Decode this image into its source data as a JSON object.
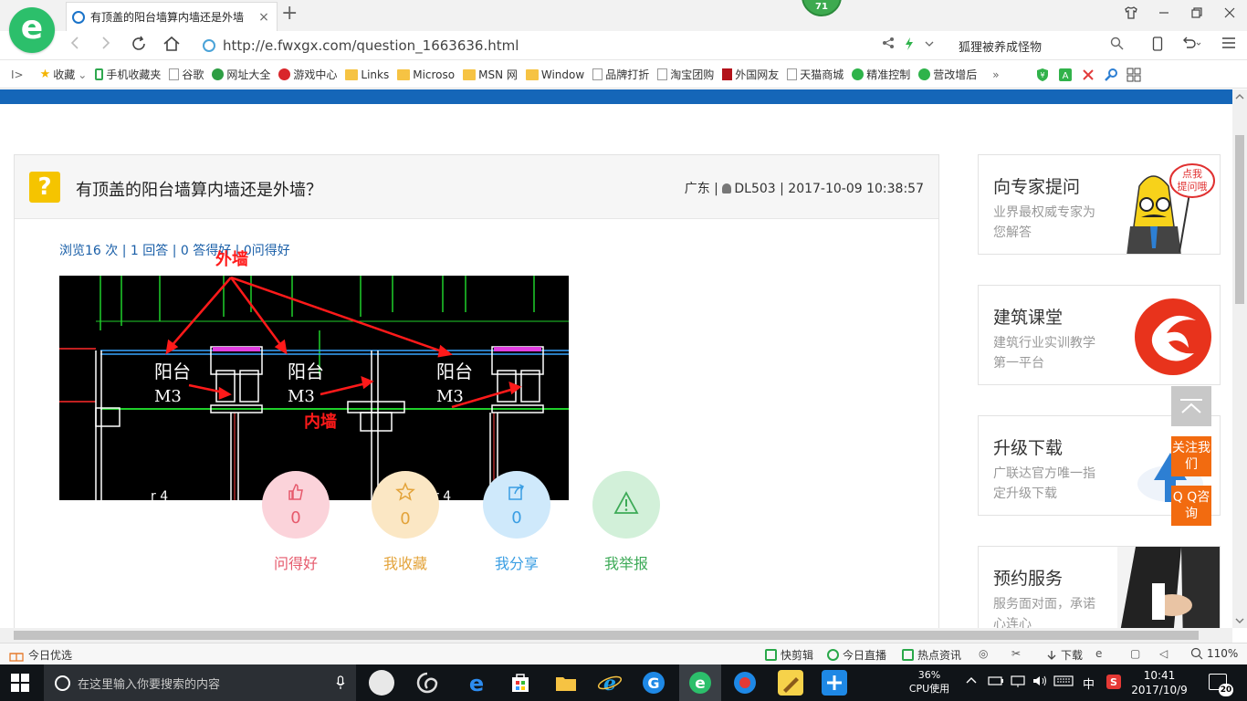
{
  "browser": {
    "tab_title": "有顶盖的阳台墙算内墙还是外墙",
    "tab_close": "×",
    "new_tab": "+",
    "ext_badge": "71",
    "url": "http://e.fwxgx.com/question_1663636.html",
    "search_hint": "狐狸被养成怪物"
  },
  "bookmarks": [
    {
      "label": "收藏",
      "icon": "star"
    },
    {
      "label": "手机收藏夹",
      "icon": "phone"
    },
    {
      "label": "谷歌",
      "icon": "page"
    },
    {
      "label": "网址大全",
      "icon": "round",
      "color": "#2e9e44"
    },
    {
      "label": "游戏中心",
      "icon": "round",
      "color": "#d9262b"
    },
    {
      "label": "Links",
      "icon": "folder"
    },
    {
      "label": "Microso",
      "icon": "folder"
    },
    {
      "label": "MSN 网",
      "icon": "folder"
    },
    {
      "label": "Window",
      "icon": "folder"
    },
    {
      "label": "品牌打折",
      "icon": "page"
    },
    {
      "label": "淘宝团购",
      "icon": "page"
    },
    {
      "label": "外国网友",
      "icon": "page",
      "color": "#b3121a"
    },
    {
      "label": "天猫商城",
      "icon": "page"
    },
    {
      "label": "精准控制",
      "icon": "round",
      "color": "#2eb34a"
    },
    {
      "label": "营改增后",
      "icon": "round",
      "color": "#2eb34a"
    }
  ],
  "bookmarks_more": "»",
  "question": {
    "title": "有顶盖的阳台墙算内墙还是外墙？",
    "region": "广东",
    "user": "DL503",
    "datetime": "2017-10-09 10:38:57",
    "stats": "浏览16 次 | 1 回答 | 0 答得好 | 0问得好"
  },
  "drawing": {
    "label_outer": "外墙",
    "label_inner": "内墙",
    "room_label": "阳台",
    "door_label": "M3"
  },
  "actions": [
    {
      "label": "问得好",
      "count": "0",
      "icon": "thumb-up-icon",
      "bg": "#fbd3da",
      "fg": "#e65a6c"
    },
    {
      "label": "我收藏",
      "count": "0",
      "icon": "star-icon",
      "bg": "#fbe7c4",
      "fg": "#e3a33a"
    },
    {
      "label": "我分享",
      "count": "0",
      "icon": "share-icon",
      "bg": "#cfe9fb",
      "fg": "#3a9ee3"
    },
    {
      "label": "我举报",
      "count": "",
      "icon": "warning-icon",
      "bg": "#d2f0d9",
      "fg": "#3daa57"
    }
  ],
  "sidebar": {
    "ask_expert": {
      "title": "向专家提问",
      "desc": "业界最权威专家为您解答",
      "bubble": "点我提问哦"
    },
    "course": {
      "title": "建筑课堂",
      "desc": "建筑行业实训教学第一平台"
    },
    "download": {
      "title": "升级下载",
      "desc": "广联达官方唯一指定升级下载"
    },
    "service": {
      "title": "预约服务",
      "desc": "服务面对面，承诺心连心"
    }
  },
  "float_buttons": {
    "follow": "关注我们",
    "qq": "Q Q咨询"
  },
  "statusbar": {
    "left": "今日优选",
    "items": [
      "快剪辑",
      "今日直播",
      "热点资讯"
    ],
    "download": "下载",
    "zoom": "110%"
  },
  "taskbar": {
    "search_placeholder": "在这里输入你要搜索的内容",
    "cpu_percent": "36%",
    "cpu_label": "CPU使用",
    "ime": "中",
    "time": "10:41",
    "date": "2017/10/9",
    "notifications": "20"
  },
  "colors": {
    "header_blue": "#1566b8",
    "accent_orange": "#f26b10",
    "link_blue": "#1a5fa8"
  }
}
